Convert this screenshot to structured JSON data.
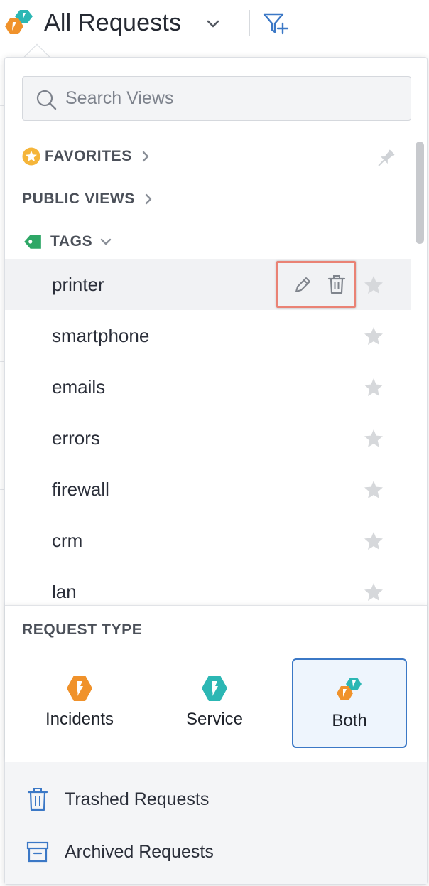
{
  "header": {
    "title": "All Requests",
    "logo_icon": "request-both-logo",
    "dropdown_icon": "chevron-down-icon",
    "filter_icon": "filter-add-icon"
  },
  "search": {
    "placeholder": "Search Views",
    "value": ""
  },
  "sections": {
    "favorites": "FAVORITES",
    "public_views": "PUBLIC VIEWS",
    "tags": "TAGS"
  },
  "tags": [
    {
      "label": "printer",
      "hovered": true
    },
    {
      "label": "smartphone"
    },
    {
      "label": "emails"
    },
    {
      "label": "errors"
    },
    {
      "label": "firewall"
    },
    {
      "label": "crm"
    },
    {
      "label": "lan"
    }
  ],
  "request_type": {
    "title": "REQUEST TYPE",
    "options": [
      {
        "label": "Incidents",
        "selected": false
      },
      {
        "label": "Service",
        "selected": false
      },
      {
        "label": "Both",
        "selected": true
      }
    ]
  },
  "footer": {
    "trashed": "Trashed Requests",
    "archived": "Archived Requests"
  },
  "colors": {
    "incident_orange": "#f0922b",
    "service_teal": "#2cb7b4",
    "accent_blue": "#3b78c6",
    "tag_green": "#2ea766",
    "favorite_yellow": "#f5b53a",
    "highlight_red": "#ea8274"
  }
}
